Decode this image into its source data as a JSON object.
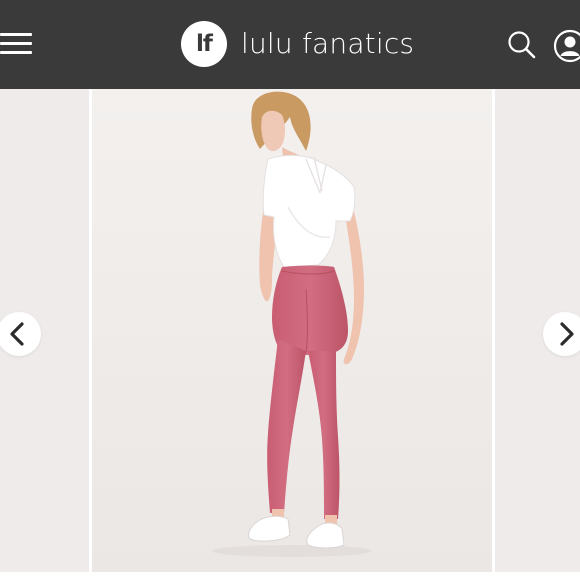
{
  "header": {
    "logo_text": "lf",
    "brand_name": "lulu fanatics",
    "colors": {
      "bar": "#3a3a3a",
      "text": "#ffffff"
    },
    "icons": [
      "menu-icon",
      "search-icon",
      "account-icon"
    ]
  },
  "carousel": {
    "icons": [
      "chevron-left-icon",
      "chevron-right-icon"
    ],
    "product_colors": {
      "leggings": "#cc6478",
      "top": "#ffffff",
      "background": "#f1eeec"
    }
  }
}
